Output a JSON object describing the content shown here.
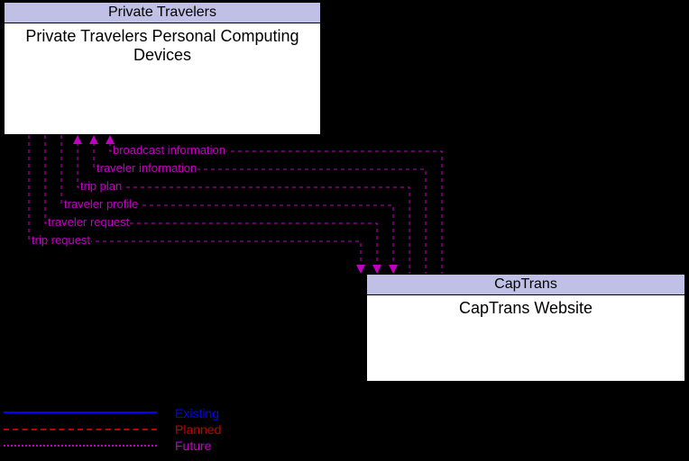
{
  "nodes": {
    "top": {
      "header": "Private Travelers",
      "title": "Private Travelers Personal Computing Devices"
    },
    "bottom": {
      "header": "CapTrans",
      "title": "CapTrans Website"
    }
  },
  "flows": [
    {
      "label": "broadcast information",
      "direction": "to_top"
    },
    {
      "label": "traveler information",
      "direction": "to_top"
    },
    {
      "label": "trip plan",
      "direction": "to_top"
    },
    {
      "label": "traveler profile",
      "direction": "to_bottom"
    },
    {
      "label": "traveler request",
      "direction": "to_bottom"
    },
    {
      "label": "trip request",
      "direction": "to_bottom"
    }
  ],
  "legend": {
    "existing": "Existing",
    "planned": "Planned",
    "future": "Future"
  }
}
